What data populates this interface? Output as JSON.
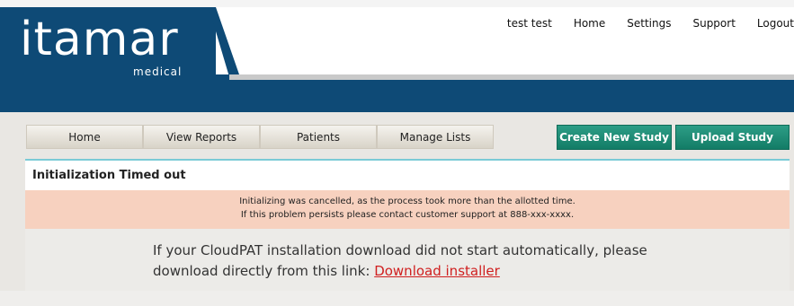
{
  "brand": {
    "name": "itamar",
    "sub": "medical"
  },
  "topnav": {
    "user": "test test",
    "home": "Home",
    "settings": "Settings",
    "support": "Support",
    "logout": "Logout"
  },
  "tabs": [
    "Home",
    "View Reports",
    "Patients",
    "Manage Lists"
  ],
  "buttons": {
    "create": "Create New Study",
    "upload": "Upload Study"
  },
  "content": {
    "title": "Initialization Timed out",
    "alert_line1": "Initializing was cancelled, as the process took more than the allotted time.",
    "alert_line2": "If this problem persists please contact customer support at 888-xxx-xxxx.",
    "msg_line1": "If your CloudPAT installation download did not start automatically, please",
    "msg_line2": "download directly from this link:",
    "link": "Download installer"
  },
  "colors": {
    "header": "#0e4a76",
    "button": "#137c66",
    "alert": "#f7d1bf",
    "link": "#d02020"
  }
}
